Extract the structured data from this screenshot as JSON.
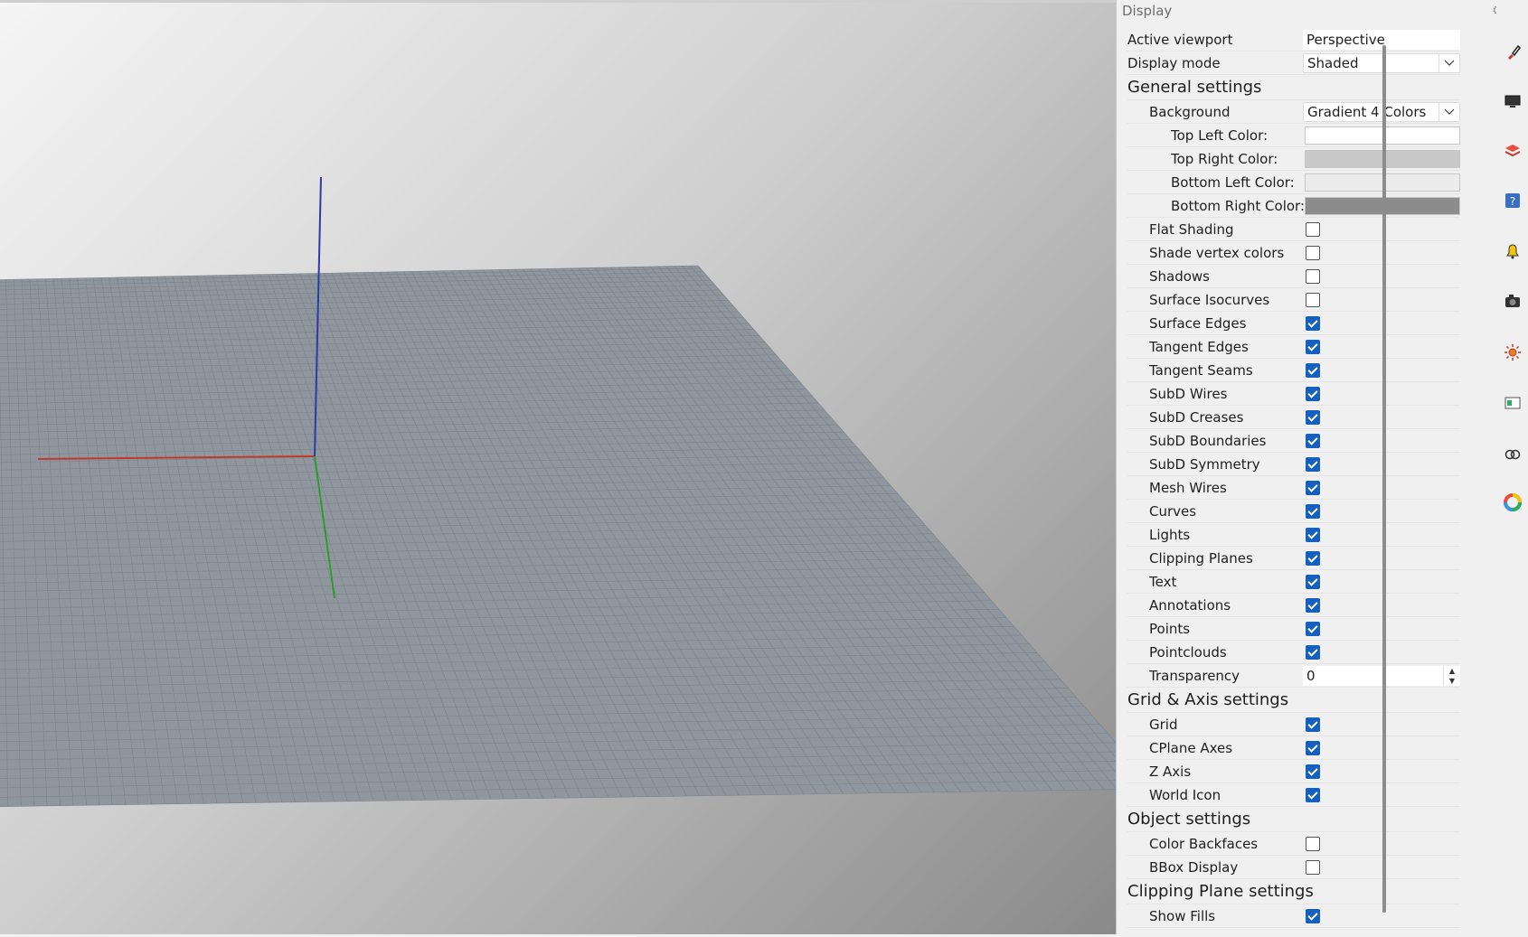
{
  "panel": {
    "title": "Display",
    "active_viewport": {
      "label": "Active viewport",
      "value": "Perspective"
    },
    "display_mode": {
      "label": "Display mode",
      "value": "Shaded"
    },
    "general": {
      "title": "General settings",
      "background": {
        "label": "Background",
        "value": "Gradient 4 Colors"
      },
      "colors": [
        {
          "label": "Top Left Color:",
          "color": "#ffffff"
        },
        {
          "label": "Top Right Color:",
          "color": "#c8c8c8"
        },
        {
          "label": "Bottom Left Color:",
          "color": "#ececec"
        },
        {
          "label": "Bottom Right Color:",
          "color": "#8c8c8c"
        }
      ],
      "toggles": [
        {
          "label": "Flat Shading",
          "checked": false
        },
        {
          "label": "Shade vertex colors",
          "checked": false
        },
        {
          "label": "Shadows",
          "checked": false
        },
        {
          "label": "Surface Isocurves",
          "checked": false
        },
        {
          "label": "Surface Edges",
          "checked": true
        },
        {
          "label": "Tangent Edges",
          "checked": true
        },
        {
          "label": "Tangent Seams",
          "checked": true
        },
        {
          "label": "SubD Wires",
          "checked": true
        },
        {
          "label": "SubD Creases",
          "checked": true
        },
        {
          "label": "SubD Boundaries",
          "checked": true
        },
        {
          "label": "SubD Symmetry",
          "checked": true
        },
        {
          "label": "Mesh Wires",
          "checked": true
        },
        {
          "label": "Curves",
          "checked": true
        },
        {
          "label": "Lights",
          "checked": true
        },
        {
          "label": "Clipping Planes",
          "checked": true
        },
        {
          "label": "Text",
          "checked": true
        },
        {
          "label": "Annotations",
          "checked": true
        },
        {
          "label": "Points",
          "checked": true
        },
        {
          "label": "Pointclouds",
          "checked": true
        }
      ],
      "transparency": {
        "label": "Transparency",
        "value": "0"
      }
    },
    "grid": {
      "title": "Grid & Axis settings",
      "toggles": [
        {
          "label": "Grid",
          "checked": true
        },
        {
          "label": "CPlane Axes",
          "checked": true
        },
        {
          "label": "Z Axis",
          "checked": true
        },
        {
          "label": "World Icon",
          "checked": true
        }
      ]
    },
    "object": {
      "title": "Object settings",
      "toggles": [
        {
          "label": "Color Backfaces",
          "checked": false
        },
        {
          "label": "BBox Display",
          "checked": false
        }
      ]
    },
    "clipping": {
      "title": "Clipping Plane settings",
      "toggles": [
        {
          "label": "Show Fills",
          "checked": true
        }
      ]
    }
  },
  "icons": [
    "paint-brush-icon",
    "display-icon",
    "layer-icon",
    "help-icon",
    "notification-icon",
    "camera-icon",
    "sun-icon",
    "rendering-icon",
    "materials-icon",
    "color-wheel-icon"
  ],
  "accent_color": "#1560bd"
}
